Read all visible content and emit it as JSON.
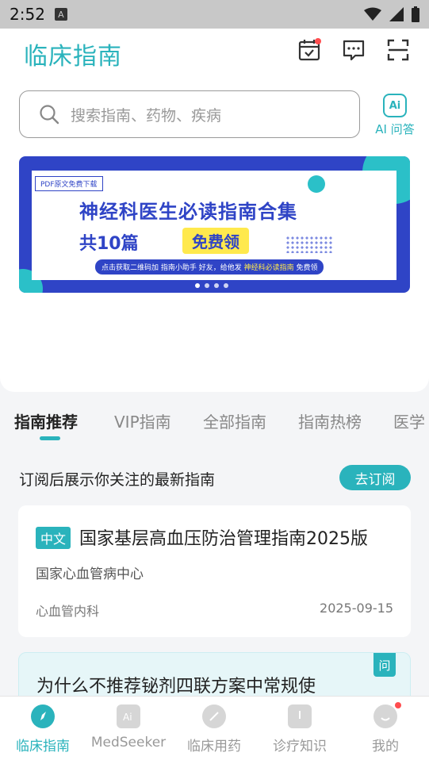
{
  "status_bar": {
    "time": "2:52",
    "a_icon": "A"
  },
  "header": {
    "logo": "临床指南",
    "icons": [
      "calendar-check-icon",
      "message-icon",
      "scan-icon"
    ]
  },
  "search": {
    "placeholder": "搜索指南、药物、疾病",
    "ai_badge": "Ai",
    "ai_label": "AI 问答"
  },
  "banner": {
    "tag": "PDF原文免费下载",
    "title": "神经科医生必读指南合集",
    "subtitle": "共10篇",
    "free": "免费领",
    "note_prefix": "点击获取二维码加 指南小助手 好友，给他发 ",
    "note_highlight": "神经科必读指南",
    "note_suffix": " 免费领"
  },
  "tabs": [
    "指南推荐",
    "VIP指南",
    "全部指南",
    "指南热榜",
    "医学"
  ],
  "subscribe": {
    "text": "订阅后展示你关注的最新指南",
    "button": "去订阅"
  },
  "card": {
    "lang": "中文",
    "title": "国家基层高血压防治管理指南2025版",
    "org": "国家心血管病中心",
    "dept": "心血管内科",
    "date": "2025-09-15"
  },
  "qa_card": {
    "tag": "问",
    "title": "为什么不推荐铋剂四联方案中常规使"
  },
  "bottom_nav": [
    {
      "label": "临床指南",
      "icon": "compass-icon"
    },
    {
      "label": "MedSeeker",
      "icon": "ai-icon"
    },
    {
      "label": "临床用药",
      "icon": "pill-icon"
    },
    {
      "label": "诊疗知识",
      "icon": "book-icon"
    },
    {
      "label": "我的",
      "icon": "profile-icon"
    }
  ],
  "colors": {
    "accent": "#2ab3bc",
    "banner_blue": "#2f44c6",
    "badge_red": "#ff4d4f"
  }
}
